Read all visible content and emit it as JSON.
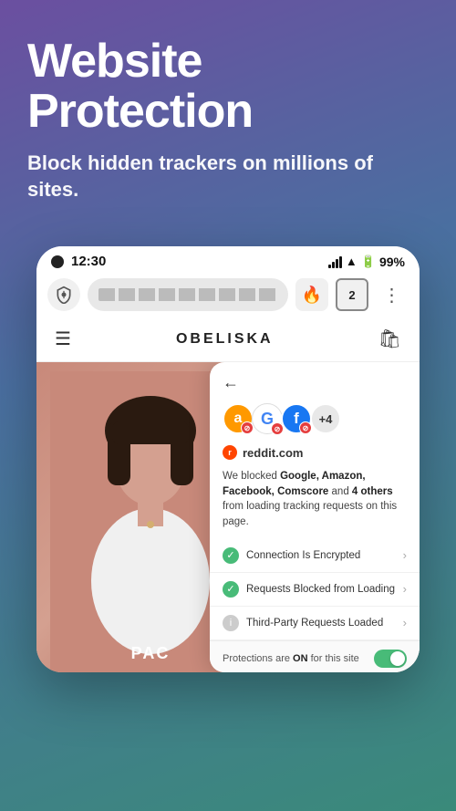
{
  "header": {
    "title": "Website Protection",
    "subtitle": "Block hidden trackers on millions of sites."
  },
  "status_bar": {
    "time": "12:30",
    "battery": "99%",
    "camera": "●"
  },
  "browser": {
    "tabs_count": "2",
    "more_menu": "⋮"
  },
  "website": {
    "site_name": "OBELISKA",
    "person_label": "PAC"
  },
  "privacy_panel": {
    "site": "reddit.com",
    "description_part1": "We blocked ",
    "description_bold": "Google, Amazon, Facebook, Comscore",
    "description_part2": " and ",
    "description_bold2": "4 others",
    "description_part3": " from loading tracking requests on this page.",
    "tracker_count": "+4",
    "items": [
      {
        "label": "Connection Is Encrypted",
        "status": "check"
      },
      {
        "label": "Requests Blocked from Loading",
        "status": "check"
      },
      {
        "label": "Third-Party Requests Loaded",
        "status": "info"
      }
    ],
    "protections_label": "Protections are",
    "protections_status": "ON",
    "protections_suffix": " for this site"
  }
}
